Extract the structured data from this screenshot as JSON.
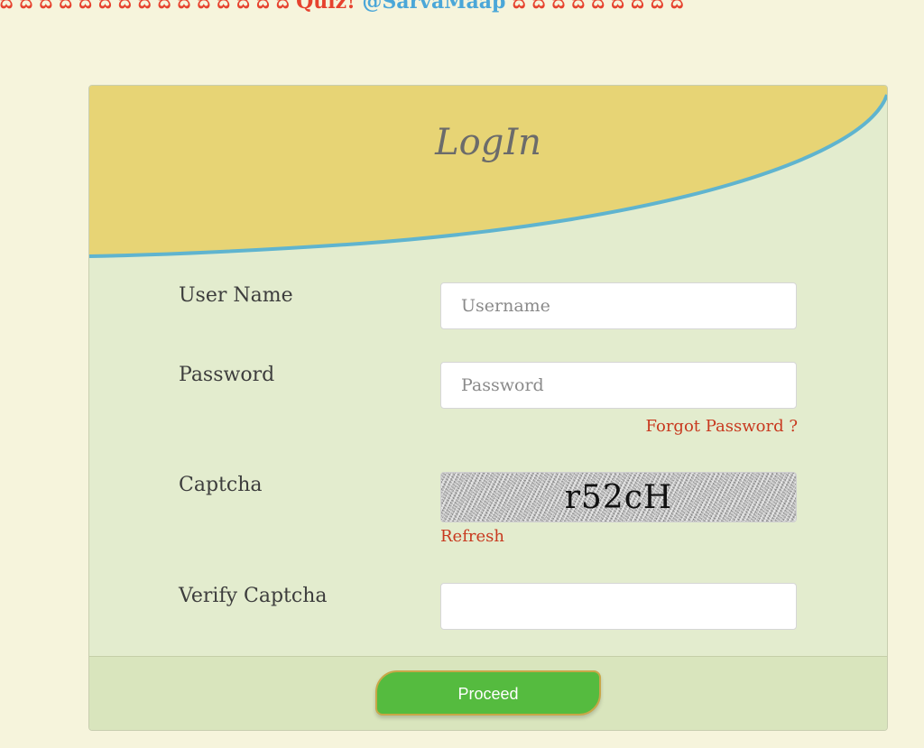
{
  "ticker": {
    "part1": "ದ ದ ದ ದ ದ ದ ದ ದ ದ ದ ದ ದ ದ ದ ದ Quiz!",
    "part2": "@SarvaMaap",
    "part3": " ದ ದ ದ ದ ದ ದ ದ ದ ದ"
  },
  "login": {
    "title": "LogIn"
  },
  "form": {
    "username_label": "User Name",
    "username_placeholder": "Username",
    "password_label": "Password",
    "password_placeholder": "Password",
    "forgot_password": "Forgot Password ?",
    "captcha_label": "Captcha",
    "captcha_code": "r52cH",
    "refresh": "Refresh",
    "verify_label": "Verify Captcha",
    "verify_value": ""
  },
  "footer": {
    "proceed_label": "Proceed"
  },
  "colors": {
    "page_bg": "#f6f4dc",
    "card_bg": "#e3ecce",
    "header_yellow": "#e7d475",
    "header_line": "#5fb4cf",
    "link_red": "#c8391f",
    "button_green": "#55bb3f"
  }
}
